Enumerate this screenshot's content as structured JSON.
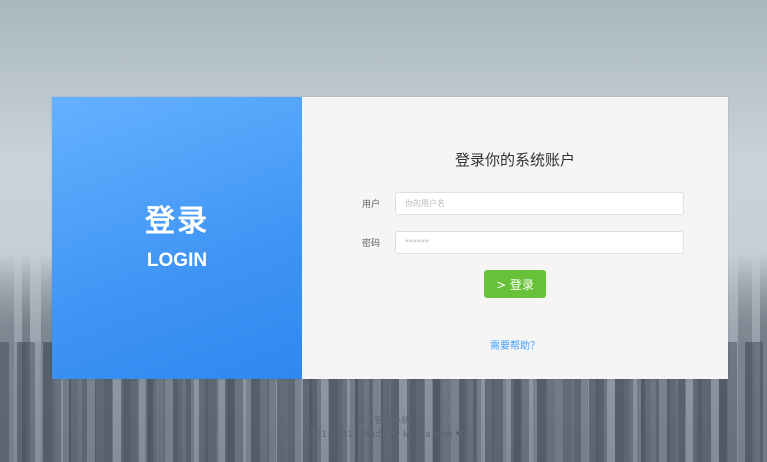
{
  "left_panel": {
    "title_cn": "登录",
    "title_en": "LOGIN"
  },
  "form": {
    "heading": "登录你的系统账户",
    "user_label": "用户",
    "user_placeholder": "你的用户名",
    "password_label": "密码",
    "password_placeholder": "******",
    "login_button": "> 登录",
    "help_link": "需要帮助？"
  },
  "footer": {
    "app_name": "员工管理系统",
    "copyright": "2021-2021 · Made by Idiana with ❤"
  },
  "colors": {
    "accent_blue": "#409eff",
    "login_green": "#67c23a"
  }
}
